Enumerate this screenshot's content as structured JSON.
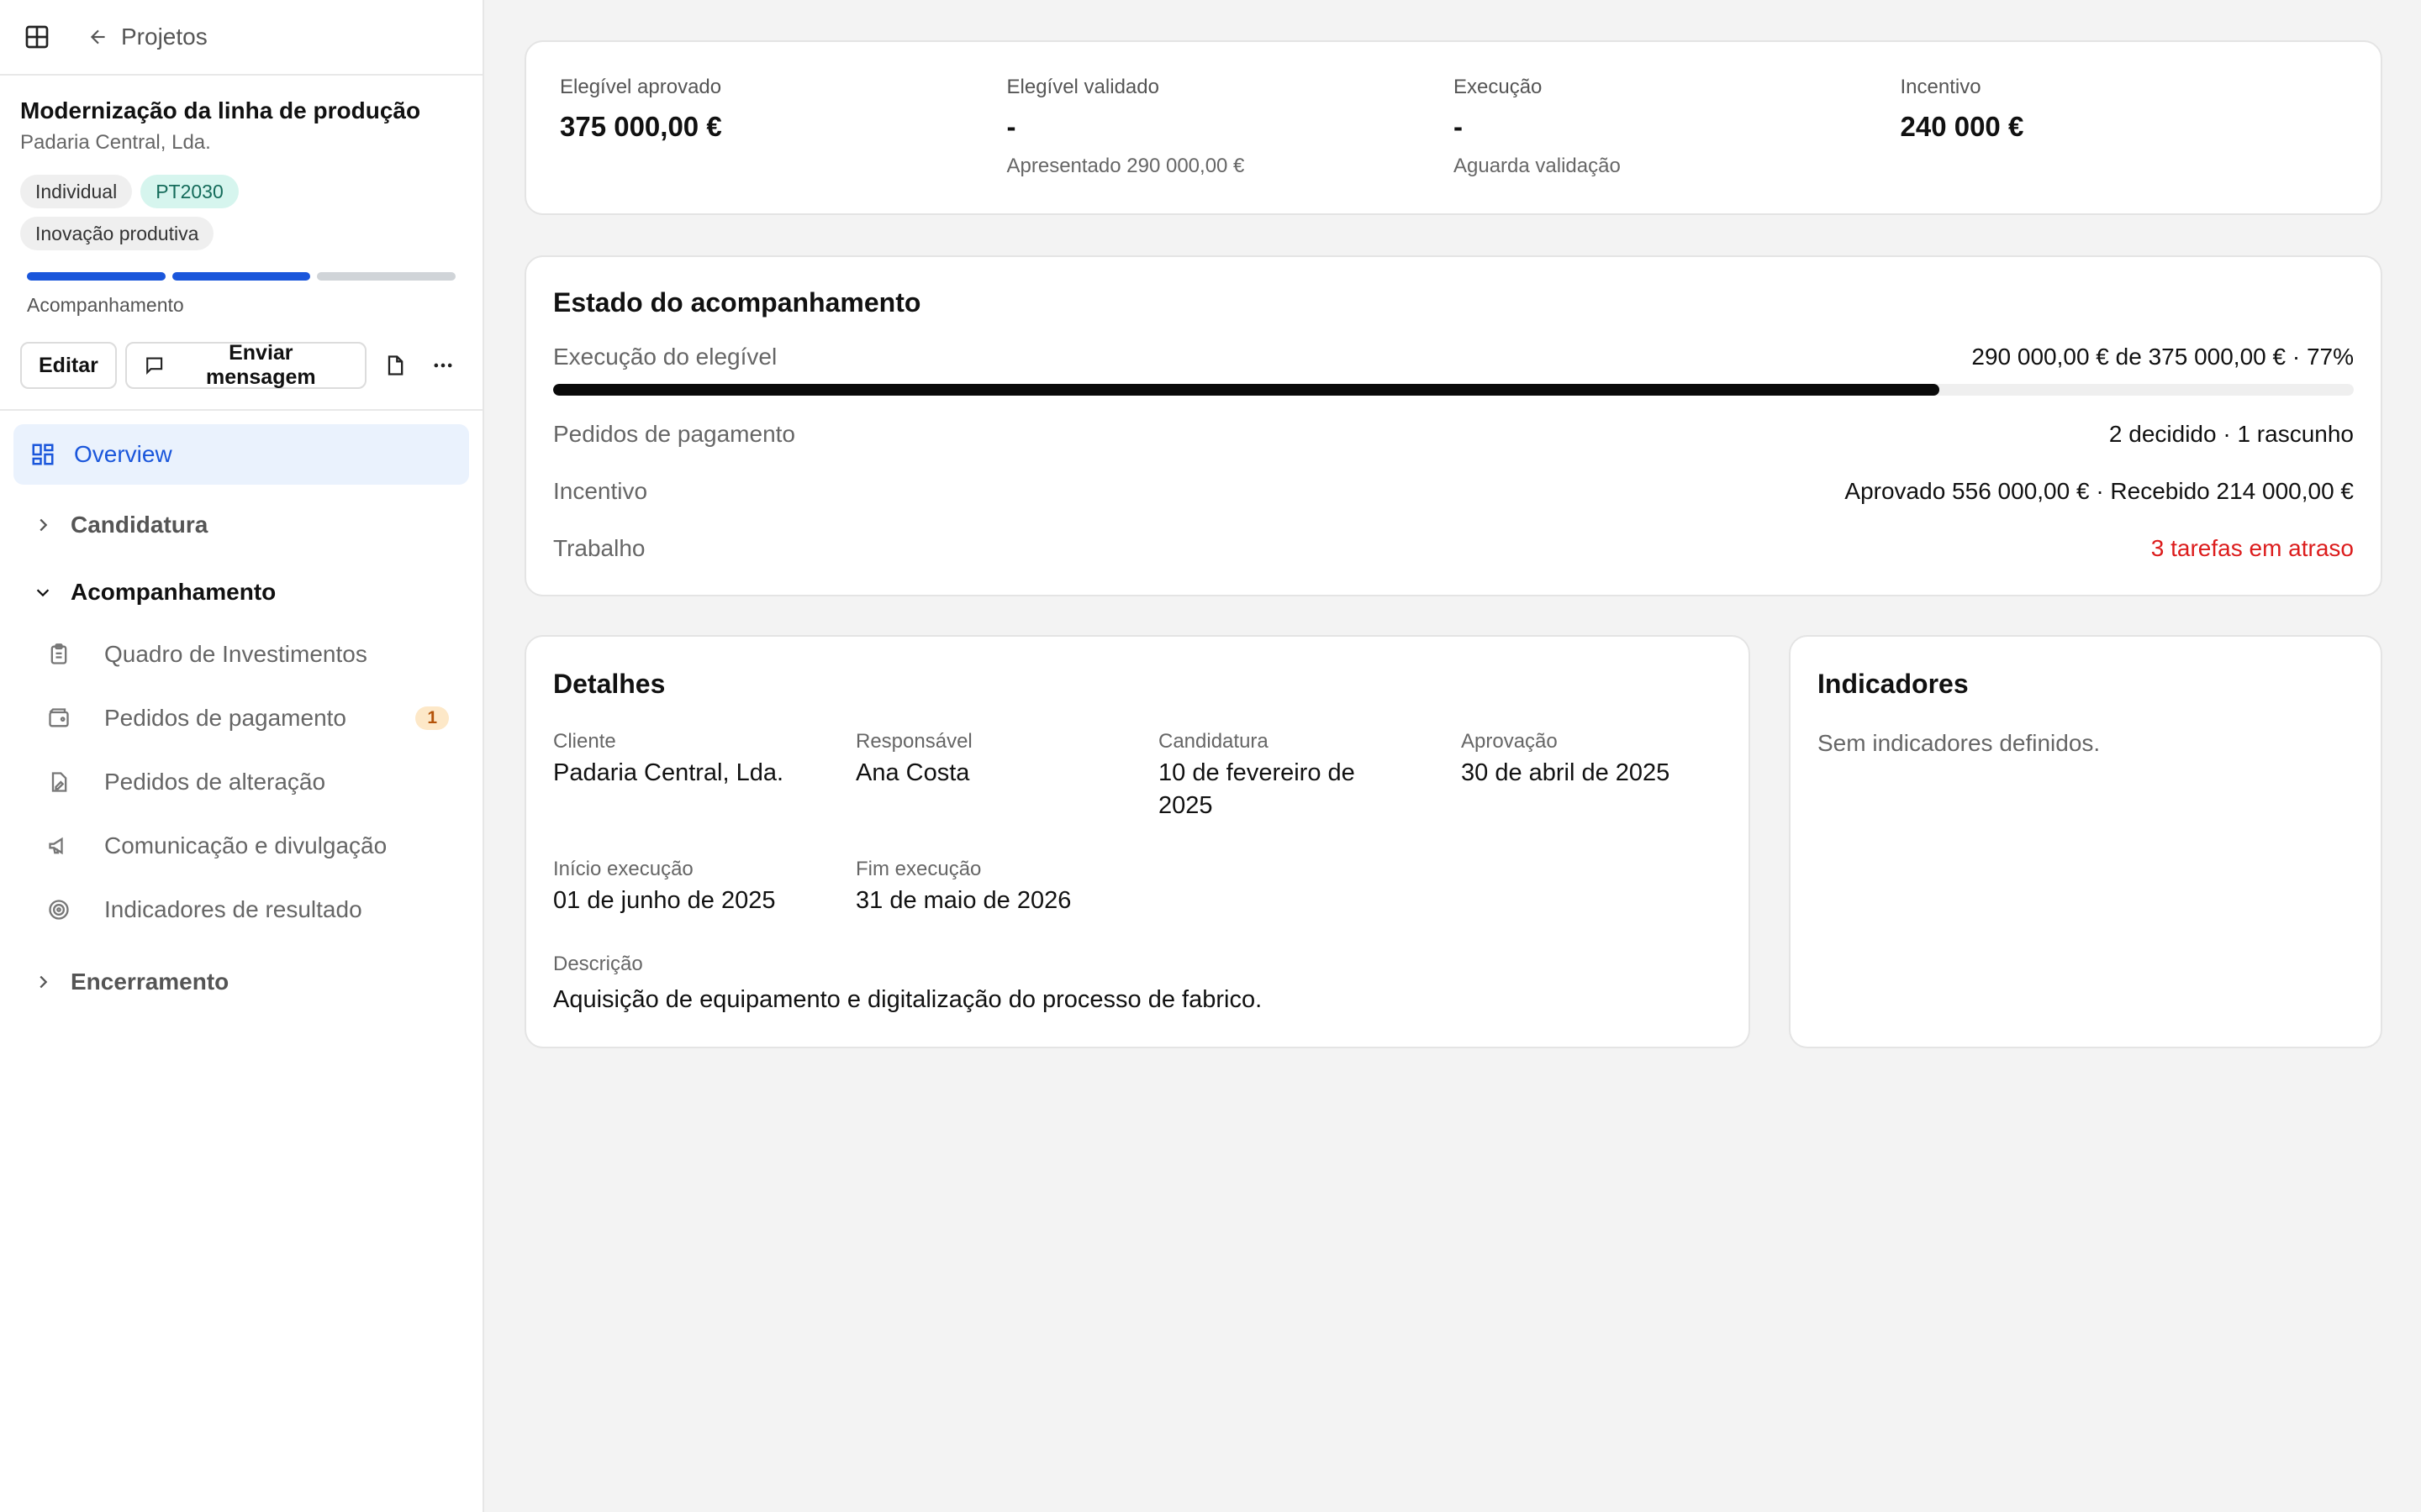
{
  "topbar": {
    "back_label": "Projetos"
  },
  "project": {
    "title": "Modernização da linha de produção",
    "client": "Padaria Central, Lda.",
    "tags": [
      "Individual",
      "PT2030",
      "Inovação produtiva"
    ],
    "phase_progress": {
      "completed_segments": 2,
      "total_segments": 3
    },
    "phase_label": "Acompanhamento"
  },
  "actions": {
    "edit_label": "Editar",
    "message_label": "Enviar mensagem"
  },
  "nav": {
    "overview": "Overview",
    "groups": {
      "candidatura": "Candidatura",
      "acompanhamento": "Acompanhamento",
      "encerramento": "Encerramento"
    },
    "sub_items": [
      {
        "label": "Quadro de Investimentos",
        "icon": "clipboard-icon"
      },
      {
        "label": "Pedidos de pagamento",
        "icon": "wallet-icon",
        "badge": "1"
      },
      {
        "label": "Pedidos de alteração",
        "icon": "file-edit-icon"
      },
      {
        "label": "Comunicação e divulgação",
        "icon": "megaphone-icon"
      },
      {
        "label": "Indicadores de resultado",
        "icon": "target-icon"
      }
    ]
  },
  "stats": [
    {
      "label": "Elegível aprovado",
      "value": "375 000,00 €",
      "sub": ""
    },
    {
      "label": "Elegível validado",
      "value": "-",
      "sub": "Apresentado 290 000,00 €"
    },
    {
      "label": "Execução",
      "value": "-",
      "sub": "Aguarda validação"
    },
    {
      "label": "Incentivo",
      "value": "240 000 €",
      "sub": ""
    }
  ],
  "estado": {
    "title": "Estado do acompanhamento",
    "exec_label": "Execução do elegível",
    "exec_value": "290 000,00 € de 375 000,00 € · 77%",
    "exec_percent": 77,
    "pedidos_label": "Pedidos de pagamento",
    "pedidos_value": "2 decidido · 1 rascunho",
    "incentivo_label": "Incentivo",
    "incentivo_value": "Aprovado 556 000,00 € · Recebido 214 000,00 €",
    "trabalho_label": "Trabalho",
    "trabalho_value": "3 tarefas em atraso"
  },
  "detalhes": {
    "title": "Detalhes",
    "fields": [
      {
        "label": "Cliente",
        "value": "Padaria Central, Lda."
      },
      {
        "label": "Responsável",
        "value": "Ana Costa"
      },
      {
        "label": "Candidatura",
        "value": "10 de fevereiro de 2025"
      },
      {
        "label": "Aprovação",
        "value": "30 de abril de 2025"
      },
      {
        "label": "Início execução",
        "value": "01 de junho de 2025"
      },
      {
        "label": "Fim execução",
        "value": "31 de maio de 2026"
      }
    ],
    "desc_label": "Descrição",
    "desc_value": "Aquisição de equipamento e digitalização do processo de fabrico."
  },
  "indicadores": {
    "title": "Indicadores",
    "empty": "Sem indicadores definidos."
  },
  "colors": {
    "accent": "#1a56db",
    "danger": "#dc1c1c",
    "pt_tag": "#d6f5ee"
  }
}
